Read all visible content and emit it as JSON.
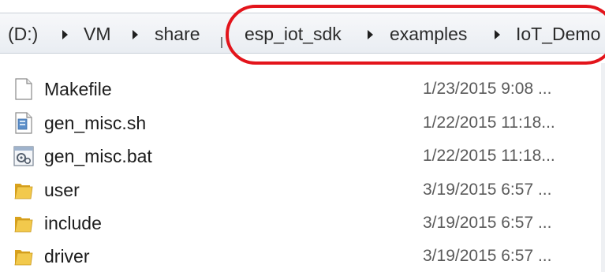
{
  "breadcrumb": {
    "items": [
      "(D:)",
      "VM",
      "share",
      "esp_iot_sdk",
      "examples",
      "IoT_Demo"
    ]
  },
  "files": [
    {
      "name": "Makefile",
      "date": "1/23/2015 9:08 ...",
      "icon": "text-file-icon"
    },
    {
      "name": "gen_misc.sh",
      "date": "1/22/2015 11:18...",
      "icon": "script-file-icon"
    },
    {
      "name": "gen_misc.bat",
      "date": "1/22/2015 11:18...",
      "icon": "batch-file-icon"
    },
    {
      "name": "user",
      "date": "3/19/2015 6:57 ...",
      "icon": "folder-icon"
    },
    {
      "name": "include",
      "date": "3/19/2015 6:57 ...",
      "icon": "folder-icon"
    },
    {
      "name": "driver",
      "date": "3/19/2015 6:57 ...",
      "icon": "folder-icon"
    }
  ],
  "colors": {
    "highlight": "#e3141b",
    "folder": "#e8b93a"
  }
}
